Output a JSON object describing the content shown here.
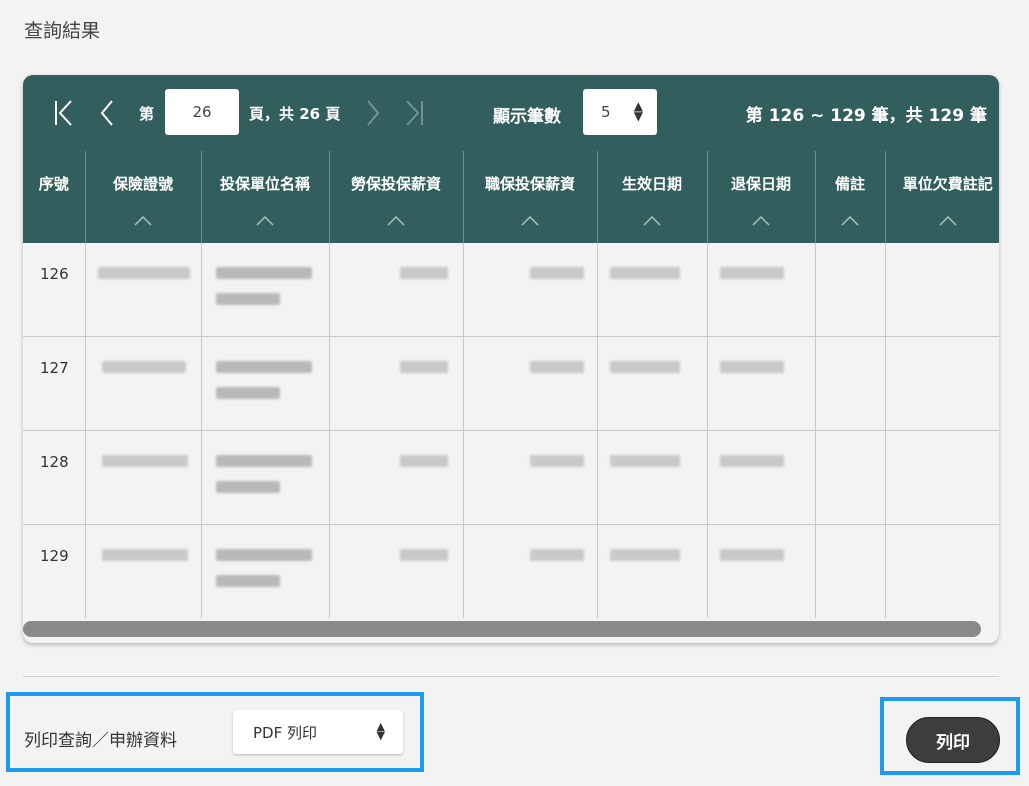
{
  "section_title": "查詢結果",
  "pagination": {
    "page_prefix": "第",
    "current_page": "26",
    "page_suffix": "頁，共 26 頁",
    "page_size_label": "顯示筆數",
    "page_size": "5",
    "range_text": "第 126 ~ 129 筆，共 129 筆"
  },
  "table": {
    "columns": [
      "序號",
      "保險證號",
      "投保單位名稱",
      "勞保投保薪資",
      "職保投保薪資",
      "生效日期",
      "退保日期",
      "備註",
      "單位欠費註記"
    ],
    "rows": [
      {
        "index": "126"
      },
      {
        "index": "127"
      },
      {
        "index": "128"
      },
      {
        "index": "129"
      }
    ]
  },
  "print": {
    "label": "列印查詢／申辦資料",
    "format": "PDF 列印",
    "button": "列印"
  },
  "colors": {
    "header": "#325f5d",
    "highlight_border": "#1e9bef",
    "button": "#3d3d3d"
  }
}
